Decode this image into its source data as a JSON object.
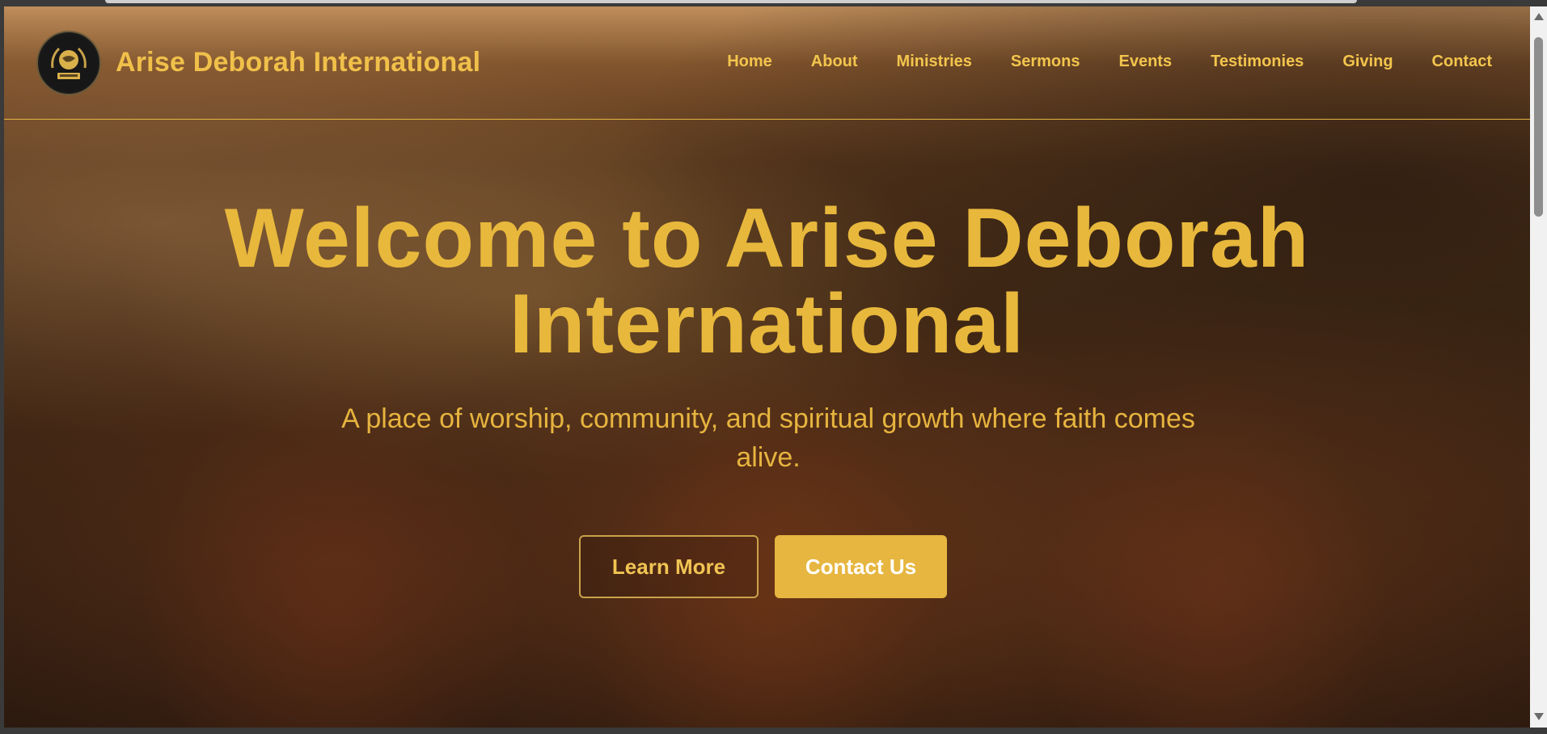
{
  "header": {
    "site_title": "Arise Deborah International",
    "logo_icon": "globe-wreath-emblem"
  },
  "nav": {
    "items": [
      {
        "label": "Home"
      },
      {
        "label": "About"
      },
      {
        "label": "Ministries"
      },
      {
        "label": "Sermons"
      },
      {
        "label": "Events"
      },
      {
        "label": "Testimonies"
      },
      {
        "label": "Giving"
      },
      {
        "label": "Contact"
      }
    ]
  },
  "hero": {
    "title_line1": "Welcome to Arise Deborah",
    "title_line2": "International",
    "subtitle": "A place of worship, community, and spiritual growth where faith comes alive.",
    "learn_more_label": "Learn More",
    "contact_label": "Contact Us"
  },
  "colors": {
    "accent_gold": "#e8b83c",
    "button_fill": "#e6b640"
  }
}
